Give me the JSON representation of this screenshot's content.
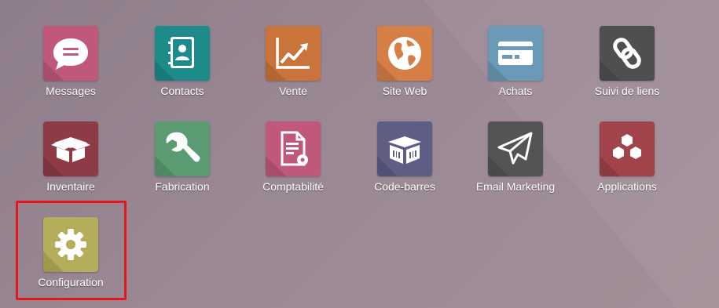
{
  "apps": [
    {
      "label": "Messages",
      "icon": "chat-bubble-icon",
      "color": "#c0587c"
    },
    {
      "label": "Contacts",
      "icon": "address-book-icon",
      "color": "#1e8b8b"
    },
    {
      "label": "Vente",
      "icon": "trend-chart-icon",
      "color": "#c9743b"
    },
    {
      "label": "Site Web",
      "icon": "globe-icon",
      "color": "#d57f47"
    },
    {
      "label": "Achats",
      "icon": "credit-card-icon",
      "color": "#6b9ab8"
    },
    {
      "label": "Suivi de liens",
      "icon": "link-icon",
      "color": "#4f4f4f"
    },
    {
      "label": "Inventaire",
      "icon": "box-icon",
      "color": "#8e3b46"
    },
    {
      "label": "Fabrication",
      "icon": "wrench-icon",
      "color": "#5a9b71"
    },
    {
      "label": "Comptabilité",
      "icon": "invoice-gear-icon",
      "color": "#c0587c"
    },
    {
      "label": "Code-barres",
      "icon": "barcode-box-icon",
      "color": "#5d5d86"
    },
    {
      "label": "Email Marketing",
      "icon": "paper-plane-icon",
      "color": "#545454"
    },
    {
      "label": "Applications",
      "icon": "cubes-icon",
      "color": "#a0434b"
    },
    {
      "label": "Configuration",
      "icon": "gear-icon",
      "color": "#b4ad5a"
    }
  ]
}
